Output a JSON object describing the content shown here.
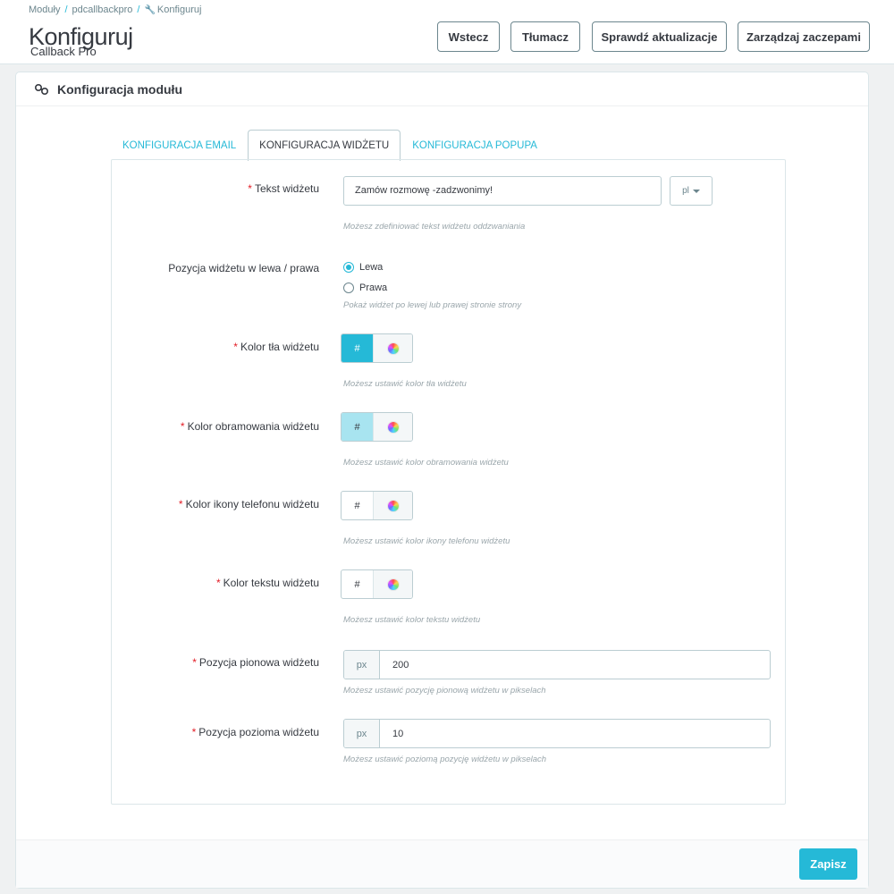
{
  "breadcrumb": {
    "items": [
      "Moduły",
      "pdcallbackpro",
      "Konfiguruj"
    ]
  },
  "header": {
    "title": "Konfiguruj",
    "subtitle": "Callback Pro"
  },
  "toolbar": {
    "back_label": "Wstecz",
    "translate_label": "Tłumacz",
    "update_label": "Sprawdź aktualizacje",
    "hooks_label": "Zarządzaj zaczepami"
  },
  "panel": {
    "heading": "Konfiguracja modułu",
    "heading_icon": "link-icon",
    "tabs": [
      {
        "label": "KONFIGURACJA EMAIL",
        "active": false
      },
      {
        "label": "KONFIGURACJA WIDŻETU",
        "active": true
      },
      {
        "label": "KONFIGURACJA POPUPA",
        "active": false
      }
    ]
  },
  "form": {
    "required_mark": "*",
    "widget_text": {
      "label": "Tekst widżetu",
      "value": "Zamów rozmowę -zadzwonimy!",
      "lang": "pl",
      "help": "Możesz zdefiniować tekst widżetu oddzwaniania"
    },
    "widget_position": {
      "label": "Pozycja widżetu w lewa / prawa",
      "options": [
        "Lewa",
        "Prawa"
      ],
      "selected": "Lewa",
      "help": "Pokaż widżet po lewej lub prawej stronie strony"
    },
    "bg_color": {
      "label": "Kolor tła widżetu",
      "hash": "#",
      "swatch": "#25b9d7",
      "help": "Możesz ustawić kolor tła widżetu"
    },
    "border_color": {
      "label": "Kolor obramowania widżetu",
      "hash": "#",
      "swatch": "#a8e4f0",
      "help": "Możesz ustawić kolor obramowania widżetu"
    },
    "icon_color": {
      "label": "Kolor ikony telefonu widżetu",
      "hash": "#",
      "swatch": "#ffffff",
      "help": "Możesz ustawić kolor ikony telefonu widżetu"
    },
    "text_color": {
      "label": "Kolor tekstu widżetu",
      "hash": "#",
      "swatch": "#ffffff",
      "help": "Możesz ustawić kolor tekstu widżetu"
    },
    "vertical_position": {
      "label": "Pozycja pionowa widżetu",
      "unit": "px",
      "value": "200",
      "help": "Możesz ustawić pozycję pionową widżetu w pikselach"
    },
    "horizontal_position": {
      "label": "Pozycja pozioma widżetu",
      "unit": "px",
      "value": "10",
      "help": "Możesz ustawić poziomą pozycję widżetu w pikselach"
    }
  },
  "footer": {
    "save_label": "Zapisz"
  },
  "colors": {
    "accent": "#25b9d7",
    "required": "#e31c25",
    "text": "#363a41"
  }
}
